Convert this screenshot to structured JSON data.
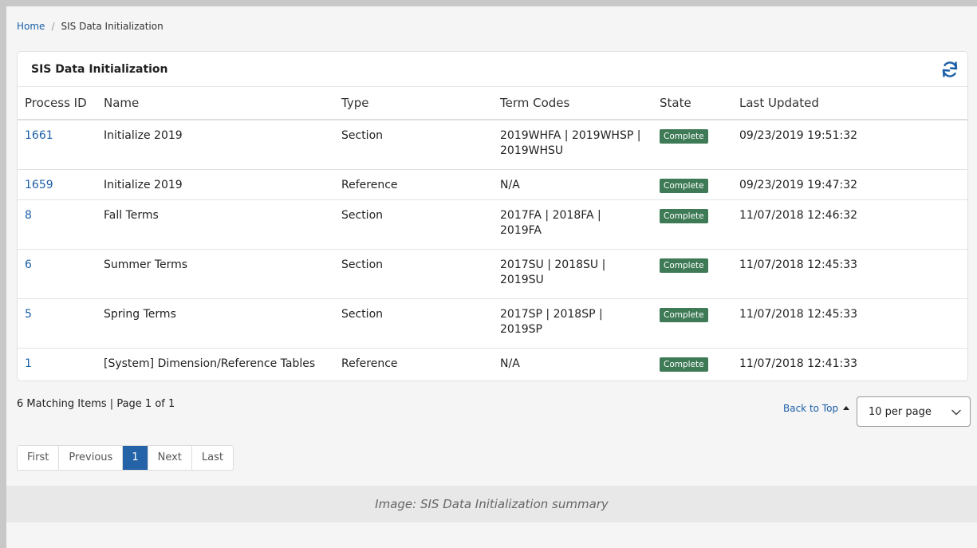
{
  "breadcrumb": {
    "home": "Home",
    "separator": "/",
    "current": "SIS Data Initialization"
  },
  "panel": {
    "title": "SIS Data Initialization",
    "refresh_icon": "refresh-icon"
  },
  "table": {
    "headers": [
      "Process ID",
      "Name",
      "Type",
      "Term Codes",
      "State",
      "Last Updated"
    ],
    "rows": [
      {
        "id": "1661",
        "name": "Initialize 2019",
        "type": "Section",
        "terms": [
          "2019WHFA | 2019WHSP |",
          "2019WHSU"
        ],
        "state": "Complete",
        "updated": "09/23/2019 19:51:32"
      },
      {
        "id": "1659",
        "name": "Initialize 2019",
        "type": "Reference",
        "terms": [
          "N/A"
        ],
        "state": "Complete",
        "updated": "09/23/2019 19:47:32"
      },
      {
        "id": "8",
        "name": "Fall Terms",
        "type": "Section",
        "terms": [
          "2017FA | 2018FA |",
          "2019FA"
        ],
        "state": "Complete",
        "updated": "11/07/2018 12:46:32"
      },
      {
        "id": "6",
        "name": "Summer Terms",
        "type": "Section",
        "terms": [
          "2017SU | 2018SU |",
          "2019SU"
        ],
        "state": "Complete",
        "updated": "11/07/2018 12:45:33"
      },
      {
        "id": "5",
        "name": "Spring Terms",
        "type": "Section",
        "terms": [
          "2017SP | 2018SP |",
          "2019SP"
        ],
        "state": "Complete",
        "updated": "11/07/2018 12:45:33"
      },
      {
        "id": "1",
        "name": "[System] Dimension/Reference Tables",
        "type": "Reference",
        "terms": [
          "N/A"
        ],
        "state": "Complete",
        "updated": "11/07/2018 12:41:33"
      }
    ]
  },
  "footer": {
    "matching": "6 Matching Items | Page 1 of 1",
    "back_to_top": "Back to Top",
    "per_page": "10 per page"
  },
  "pagination": {
    "first": "First",
    "previous": "Previous",
    "current": "1",
    "next": "Next",
    "last": "Last"
  },
  "caption": "Image: SIS Data Initialization summary",
  "colors": {
    "link": "#1a5fa8",
    "badge": "#3d7a55",
    "active_page": "#2563a8"
  }
}
